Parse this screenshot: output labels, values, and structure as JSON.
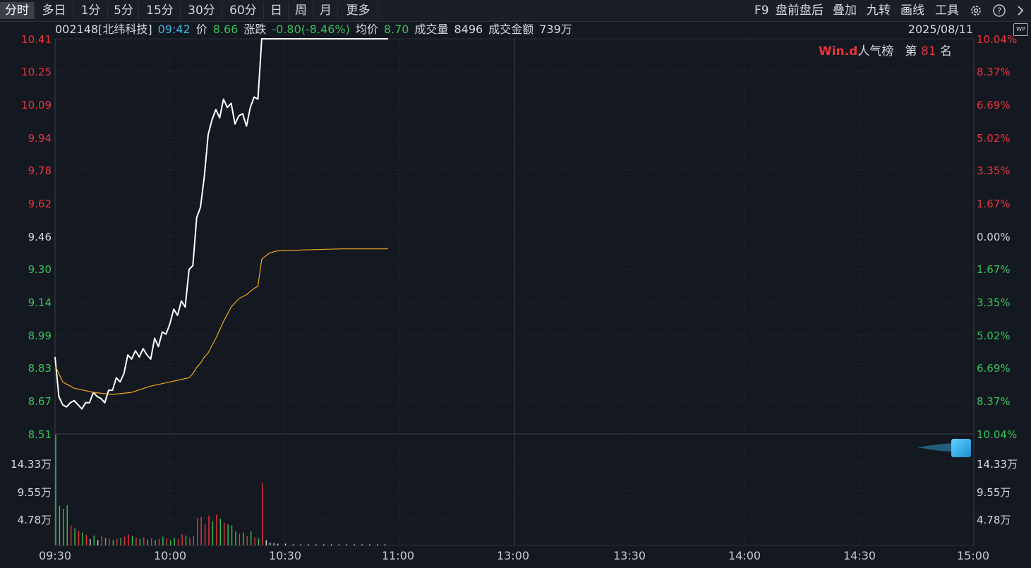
{
  "toolbar": {
    "tabs": [
      "分时",
      "多日",
      "1分",
      "5分",
      "15分",
      "30分",
      "60分",
      "日",
      "周",
      "月",
      "更多"
    ],
    "active_tab": "分时",
    "right_tools": [
      "F9",
      "盘前盘后",
      "叠加",
      "九转",
      "画线",
      "工具"
    ],
    "right_icons": [
      "gear-icon",
      "help-icon",
      "chevron-right-icon"
    ]
  },
  "info": {
    "code_name": "002148[北纬科技]",
    "time": "09:42",
    "price_label": "价",
    "price": "8.66",
    "change_label": "涨跌",
    "change": "-0.80(-8.46%)",
    "avg_label": "均价",
    "avg": "8.70",
    "volume_label": "成交量",
    "volume": "8496",
    "amount_label": "成交金额",
    "amount": "739万",
    "date": "2025/08/11",
    "wp_badge": "WP"
  },
  "rank": {
    "logo": "Win.d",
    "list_name": "人气榜",
    "prefix": "第",
    "number": "81",
    "suffix": "名"
  },
  "axes": {
    "price_ticks": [
      "10.41",
      "10.25",
      "10.09",
      "9.94",
      "9.78",
      "9.62",
      "9.46",
      "9.30",
      "9.14",
      "8.99",
      "8.83",
      "8.67",
      "8.51"
    ],
    "pct_ticks": [
      "10.04%",
      "8.37%",
      "6.69%",
      "5.02%",
      "3.35%",
      "1.67%",
      "0.00%",
      "1.67%",
      "3.35%",
      "5.02%",
      "6.69%",
      "8.37%",
      "10.04%"
    ],
    "vol_ticks": [
      "14.33万",
      "9.55万",
      "4.78万"
    ],
    "time_ticks": [
      "09:30",
      "10:00",
      "10:30",
      "11:00",
      "13:00",
      "13:30",
      "14:00",
      "14:30",
      "15:00"
    ]
  },
  "chart_data": {
    "type": "line",
    "x_unit": "trading minute index since 09:30 (0-240)",
    "ylim": [
      8.51,
      10.41
    ],
    "prev_close": 9.46,
    "series": [
      {
        "values": [
          [
            0,
            8.88
          ],
          [
            1,
            8.69
          ],
          [
            2,
            8.65
          ],
          [
            3,
            8.64
          ],
          [
            4,
            8.66
          ],
          [
            5,
            8.67
          ],
          [
            6,
            8.65
          ],
          [
            7,
            8.63
          ],
          [
            8,
            8.66
          ],
          [
            9,
            8.66
          ],
          [
            10,
            8.71
          ],
          [
            11,
            8.69
          ],
          [
            12,
            8.68
          ],
          [
            13,
            8.66
          ],
          [
            14,
            8.72
          ],
          [
            15,
            8.72
          ],
          [
            16,
            8.78
          ],
          [
            17,
            8.76
          ],
          [
            18,
            8.8
          ],
          [
            19,
            8.89
          ],
          [
            20,
            8.87
          ],
          [
            21,
            8.91
          ],
          [
            22,
            8.88
          ],
          [
            23,
            8.92
          ],
          [
            24,
            8.89
          ],
          [
            25,
            8.87
          ],
          [
            26,
            8.97
          ],
          [
            27,
            8.93
          ],
          [
            28,
            9.0
          ],
          [
            29,
            8.99
          ],
          [
            30,
            9.04
          ],
          [
            31,
            9.11
          ],
          [
            32,
            9.08
          ],
          [
            33,
            9.15
          ],
          [
            34,
            9.12
          ],
          [
            35,
            9.3
          ],
          [
            36,
            9.32
          ],
          [
            37,
            9.55
          ],
          [
            38,
            9.6
          ],
          [
            39,
            9.75
          ],
          [
            40,
            9.95
          ],
          [
            41,
            10.02
          ],
          [
            42,
            10.07
          ],
          [
            43,
            10.03
          ],
          [
            44,
            10.12
          ],
          [
            45,
            10.08
          ],
          [
            46,
            10.1
          ],
          [
            47,
            10.0
          ],
          [
            48,
            10.04
          ],
          [
            49,
            10.05
          ],
          [
            50,
            9.99
          ],
          [
            51,
            10.08
          ],
          [
            52,
            10.13
          ],
          [
            53,
            10.12
          ],
          [
            54,
            10.41
          ],
          [
            55,
            10.41
          ],
          [
            56,
            10.41
          ],
          [
            57,
            10.41
          ],
          [
            58,
            10.41
          ],
          [
            59,
            10.41
          ],
          [
            60,
            10.41
          ],
          [
            61,
            10.41
          ],
          [
            62,
            10.41
          ],
          [
            63,
            10.41
          ],
          [
            64,
            10.41
          ],
          [
            65,
            10.41
          ],
          [
            66,
            10.41
          ],
          [
            67,
            10.41
          ],
          [
            68,
            10.41
          ],
          [
            69,
            10.41
          ],
          [
            70,
            10.41
          ],
          [
            71,
            10.41
          ],
          [
            72,
            10.41
          ],
          [
            73,
            10.41
          ],
          [
            74,
            10.41
          ],
          [
            75,
            10.41
          ],
          [
            76,
            10.41
          ],
          [
            77,
            10.41
          ],
          [
            78,
            10.41
          ],
          [
            79,
            10.41
          ],
          [
            80,
            10.41
          ],
          [
            81,
            10.41
          ],
          [
            82,
            10.41
          ],
          [
            83,
            10.41
          ],
          [
            84,
            10.41
          ],
          [
            85,
            10.41
          ],
          [
            86,
            10.41
          ],
          [
            87,
            10.41
          ]
        ],
        "color": "#ffffff"
      },
      {
        "values": [
          [
            0,
            8.84
          ],
          [
            2,
            8.76
          ],
          [
            5,
            8.73
          ],
          [
            10,
            8.71
          ],
          [
            15,
            8.7
          ],
          [
            20,
            8.71
          ],
          [
            25,
            8.74
          ],
          [
            30,
            8.76
          ],
          [
            35,
            8.78
          ],
          [
            36,
            8.8
          ],
          [
            37,
            8.83
          ],
          [
            38,
            8.85
          ],
          [
            39,
            8.88
          ],
          [
            40,
            8.9
          ],
          [
            42,
            8.97
          ],
          [
            44,
            9.05
          ],
          [
            46,
            9.12
          ],
          [
            48,
            9.16
          ],
          [
            50,
            9.18
          ],
          [
            52,
            9.21
          ],
          [
            53,
            9.22
          ],
          [
            54,
            9.35
          ],
          [
            56,
            9.38
          ],
          [
            58,
            9.39
          ],
          [
            65,
            9.395
          ],
          [
            75,
            9.4
          ],
          [
            87,
            9.4
          ]
        ],
        "color": "#f0a91e"
      }
    ],
    "volume": {
      "vlim": [
        0,
        19.11
      ],
      "bars": [
        [
          0,
          "g",
          19.0
        ],
        [
          1,
          "g",
          6.8
        ],
        [
          2,
          "g",
          6.3
        ],
        [
          3,
          "g",
          6.9
        ],
        [
          4,
          "r",
          3.4
        ],
        [
          5,
          "g",
          2.9
        ],
        [
          6,
          "r",
          2.5
        ],
        [
          7,
          "g",
          2.2
        ],
        [
          8,
          "r",
          1.8
        ],
        [
          9,
          "w",
          1.1
        ],
        [
          10,
          "g",
          1.7
        ],
        [
          11,
          "w",
          0.9
        ],
        [
          12,
          "r",
          1.6
        ],
        [
          13,
          "g",
          1.3
        ],
        [
          14,
          "r",
          1.1
        ],
        [
          15,
          "g",
          0.9
        ],
        [
          16,
          "r",
          1.1
        ],
        [
          17,
          "g",
          1.3
        ],
        [
          18,
          "r",
          1.5
        ],
        [
          19,
          "r",
          1.9
        ],
        [
          20,
          "g",
          1.6
        ],
        [
          21,
          "r",
          1.3
        ],
        [
          22,
          "g",
          1.1
        ],
        [
          23,
          "r",
          1.4
        ],
        [
          24,
          "g",
          1.0
        ],
        [
          25,
          "r",
          1.2
        ],
        [
          26,
          "g",
          0.9
        ],
        [
          27,
          "r",
          1.1
        ],
        [
          28,
          "g",
          1.5
        ],
        [
          29,
          "r",
          1.2
        ],
        [
          30,
          "g",
          0.9
        ],
        [
          31,
          "g",
          1.3
        ],
        [
          32,
          "r",
          1.1
        ],
        [
          33,
          "r",
          1.9
        ],
        [
          34,
          "g",
          1.7
        ],
        [
          35,
          "r",
          1.3
        ],
        [
          36,
          "r",
          1.6
        ],
        [
          37,
          "r",
          4.6
        ],
        [
          38,
          "r",
          4.9
        ],
        [
          39,
          "r",
          3.6
        ],
        [
          40,
          "r",
          5.1
        ],
        [
          41,
          "g",
          4.1
        ],
        [
          42,
          "r",
          5.3
        ],
        [
          43,
          "g",
          4.6
        ],
        [
          44,
          "r",
          3.9
        ],
        [
          45,
          "g",
          3.6
        ],
        [
          46,
          "g",
          3.4
        ],
        [
          47,
          "g",
          2.4
        ],
        [
          48,
          "r",
          2.0
        ],
        [
          49,
          "g",
          2.2
        ],
        [
          50,
          "r",
          1.6
        ],
        [
          51,
          "g",
          2.4
        ],
        [
          52,
          "r",
          1.4
        ],
        [
          53,
          "g",
          1.2
        ],
        [
          54,
          "r",
          10.7
        ],
        [
          55,
          "w",
          0.9
        ],
        [
          56,
          "w",
          0.5
        ],
        [
          57,
          "w",
          0.4
        ],
        [
          58,
          "w",
          0.3
        ],
        [
          60,
          "w",
          0.3
        ],
        [
          62,
          "w",
          0.2
        ],
        [
          64,
          "w",
          0.2
        ],
        [
          66,
          "w",
          0.2
        ],
        [
          68,
          "w",
          0.2
        ],
        [
          70,
          "w",
          0.2
        ],
        [
          72,
          "w",
          0.2
        ],
        [
          74,
          "w",
          0.2
        ],
        [
          76,
          "w",
          0.2
        ],
        [
          78,
          "w",
          0.2
        ],
        [
          80,
          "w",
          0.2
        ],
        [
          82,
          "w",
          0.2
        ],
        [
          84,
          "w",
          0.2
        ],
        [
          86,
          "w",
          0.2
        ]
      ]
    }
  }
}
